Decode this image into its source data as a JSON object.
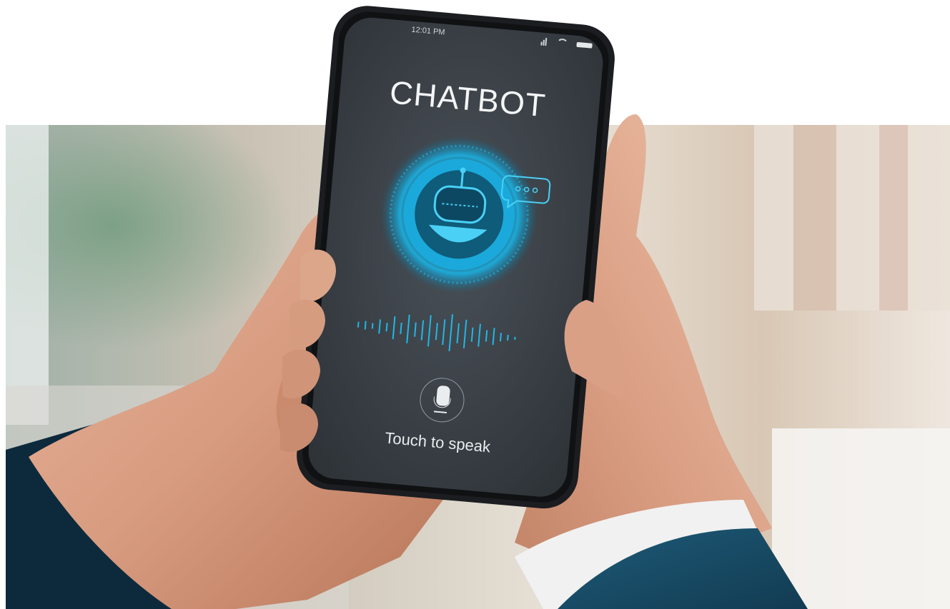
{
  "phone": {
    "status_time": "12:01 PM",
    "app_title": "CHATBOT",
    "prompt": "Touch to speak"
  },
  "icons": {
    "robot": "robot-icon",
    "chat_bubble": "chat-bubble-icon",
    "microphone": "microphone-icon",
    "signal": "signal-icon",
    "wifi": "wifi-icon",
    "battery": "battery-icon"
  },
  "colors": {
    "accent": "#1fb8e8",
    "screen": "#3b4148",
    "sleeve": "#1e5b78"
  }
}
